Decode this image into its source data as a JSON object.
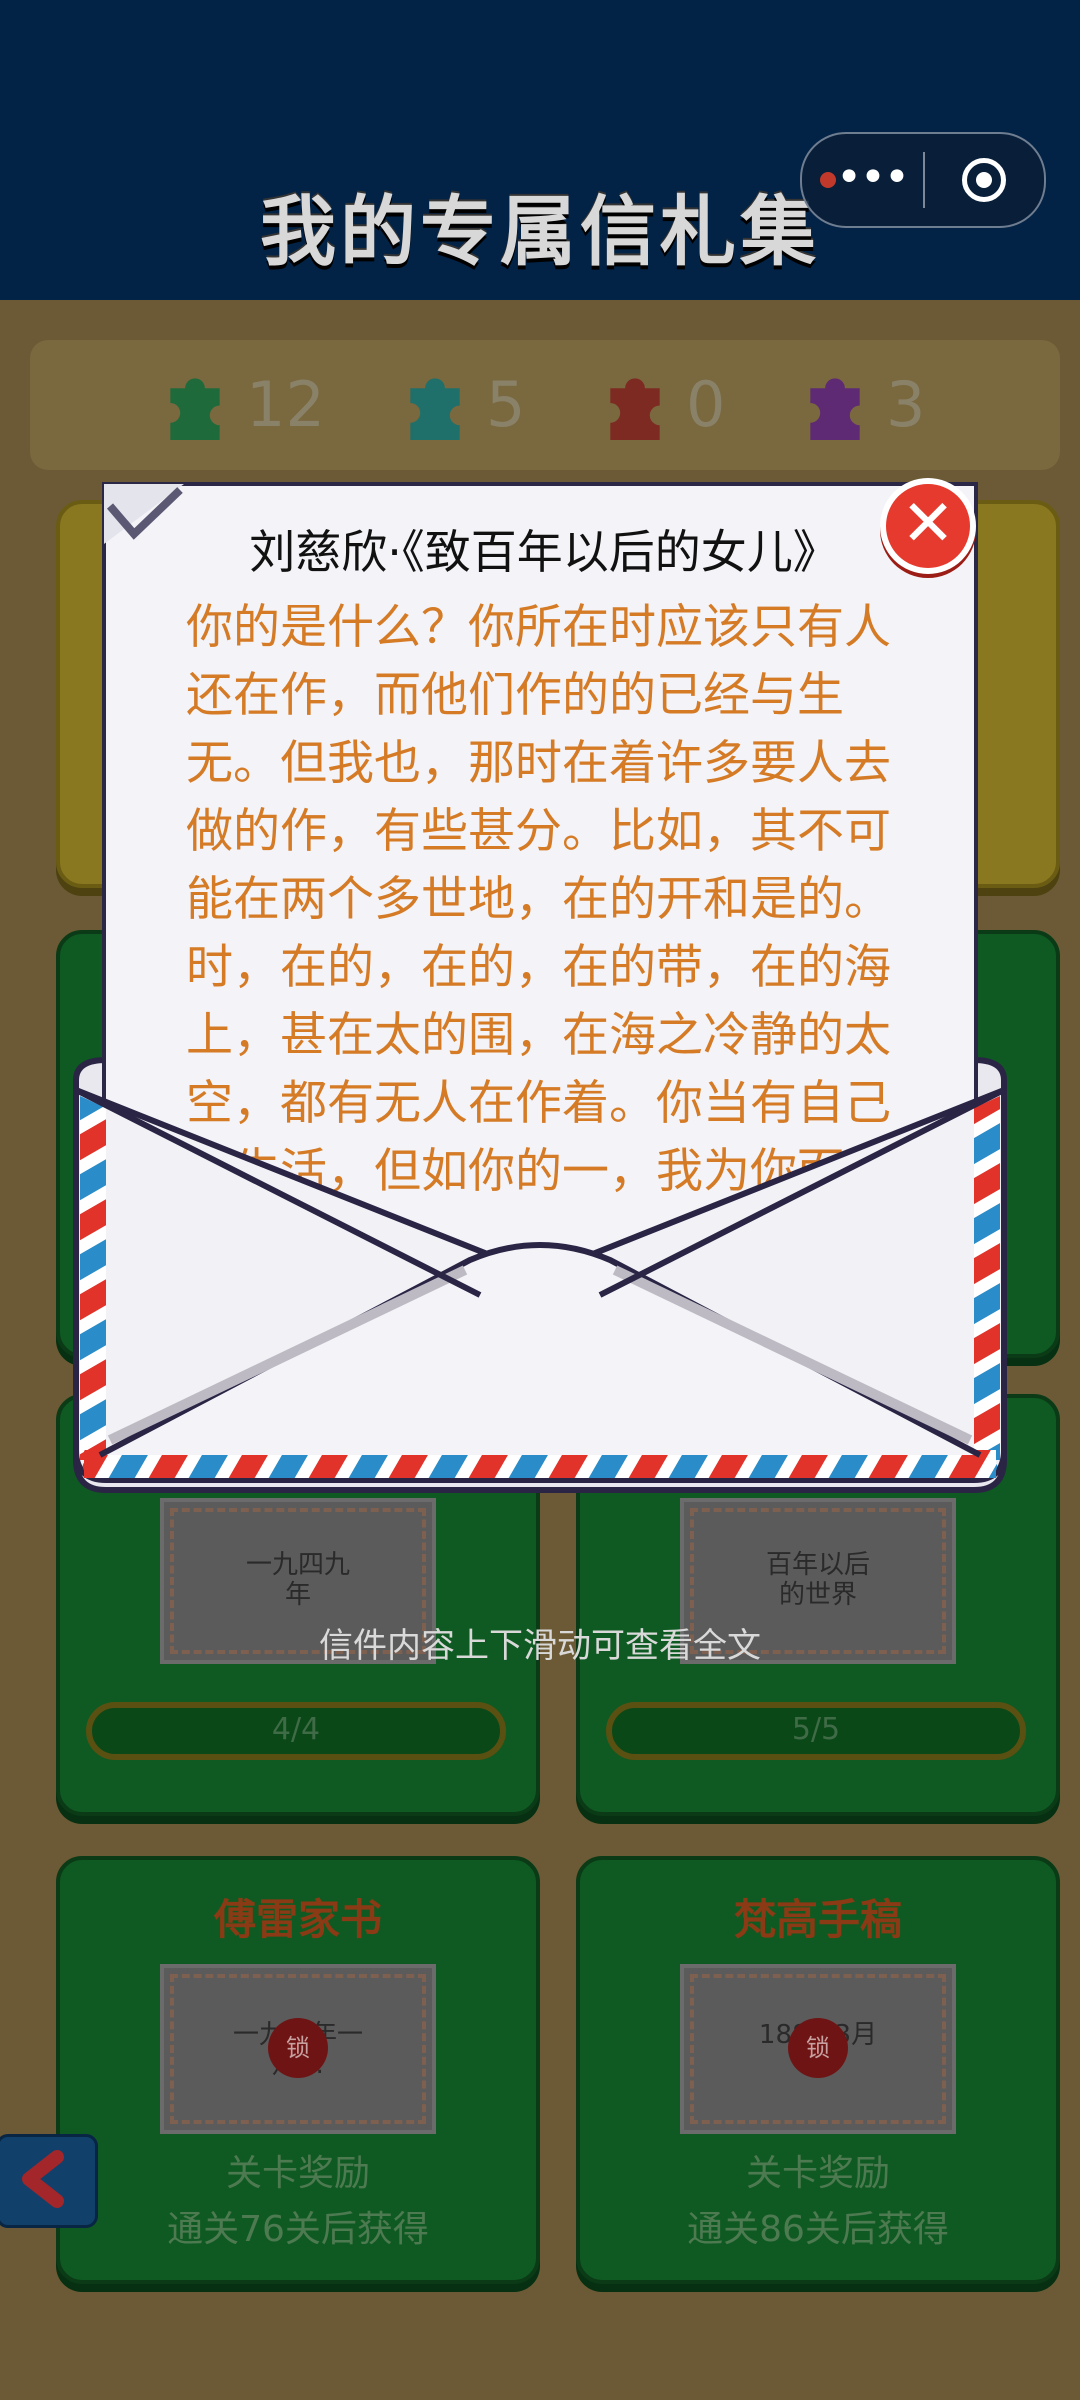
{
  "header": {
    "title": "我的专属信札集"
  },
  "counters": [
    {
      "color": "#1f6a3b",
      "value": "12"
    },
    {
      "color": "#1f6f6a",
      "value": "5"
    },
    {
      "color": "#7d2a22",
      "value": "0"
    },
    {
      "color": "#5d2a73",
      "value": "3"
    }
  ],
  "cards": {
    "row3_left": {
      "envelope_text": "一九四九\n年",
      "progress": "4/4"
    },
    "row3_right": {
      "envelope_text": "百年以后\n的世界",
      "progress": "5/5"
    },
    "row4_left": {
      "title": "傅雷家书",
      "envelope_text": "一九…年一\n月…",
      "lock": "锁",
      "reward_line1": "关卡奖励",
      "reward_line2": "通关76关后获得"
    },
    "row4_right": {
      "title": "梵高手稿",
      "envelope_text": "188…3月\n…",
      "lock": "锁",
      "reward_line1": "关卡奖励",
      "reward_line2": "通关86关后获得"
    }
  },
  "letter": {
    "title": "刘慈欣·《致百年以后的女儿》",
    "body": "你的是什么？你所在时应该只有人还在作，而他们作的的已经与生无。但我也，那时在着许多要人去做的作，有些甚分。比如，其不可能在两个多世地，在的开和是的。时，在的，在的，在的带，在的海上，甚在太的围，在海之冷静的太空，都有无人在作着。你当有自己的生活，但如你的一，我为你而"
  },
  "hint": "信件内容上下滑动可查看全文",
  "colors": {
    "header_bg": "#022246",
    "letter_text": "#d57b26",
    "close_red": "#e63a2e"
  }
}
